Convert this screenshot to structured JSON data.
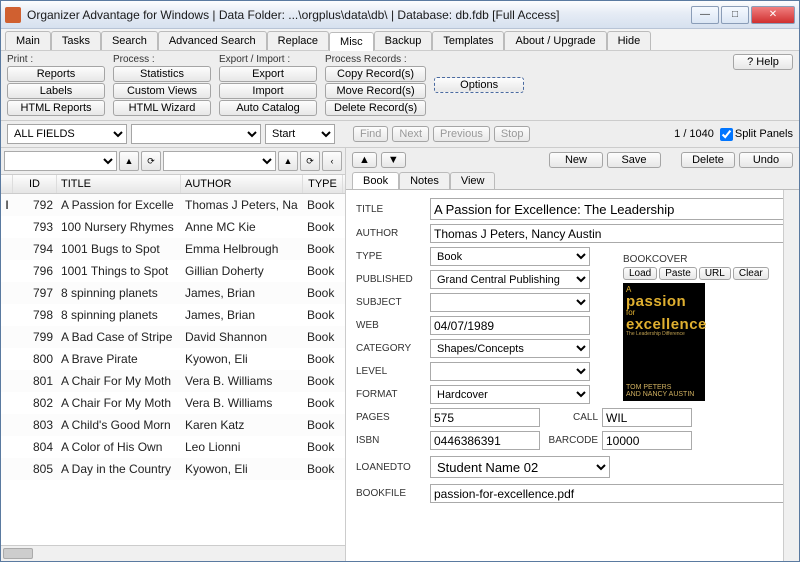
{
  "window": {
    "title": "Organizer Advantage for Windows | Data Folder: ...\\orgplus\\data\\db\\ | Database: db.fdb [Full Access]"
  },
  "menu": {
    "items": [
      "Main",
      "Tasks",
      "Search",
      "Advanced Search",
      "Replace",
      "Misc",
      "Backup",
      "Templates",
      "About / Upgrade",
      "Hide"
    ],
    "active": "Misc"
  },
  "ribbon": {
    "print": {
      "label": "Print :",
      "buttons": [
        "Reports",
        "Labels",
        "HTML Reports"
      ]
    },
    "process": {
      "label": "Process :",
      "buttons": [
        "Statistics",
        "Custom Views",
        "HTML Wizard"
      ]
    },
    "export": {
      "label": "Export / Import :",
      "buttons": [
        "Export",
        "Import",
        "Auto Catalog"
      ]
    },
    "records": {
      "label": "Process Records :",
      "buttons": [
        "Copy Record(s)",
        "Move Record(s)",
        "Delete Record(s)"
      ]
    },
    "options": "Options",
    "help": "Help"
  },
  "filter": {
    "field": "ALL FIELDS",
    "start": "Start",
    "nav": [
      "Find",
      "Next",
      "Previous",
      "Stop"
    ],
    "counter": "1 / 1040",
    "split": "Split Panels",
    "split_checked": true
  },
  "grid": {
    "headers": [
      "ID",
      "TITLE",
      "AUTHOR",
      "TYPE"
    ],
    "rows": [
      {
        "id": "792",
        "title": "A Passion for Excelle",
        "author": "Thomas J Peters, Na",
        "type": "Book",
        "sel": true
      },
      {
        "id": "793",
        "title": "100 Nursery Rhymes",
        "author": "Anne MC Kie",
        "type": "Book"
      },
      {
        "id": "794",
        "title": "1001 Bugs to Spot",
        "author": "Emma Helbrough",
        "type": "Book"
      },
      {
        "id": "796",
        "title": "1001 Things to Spot",
        "author": "Gillian Doherty",
        "type": "Book"
      },
      {
        "id": "797",
        "title": "8 spinning planets",
        "author": "James, Brian",
        "type": "Book"
      },
      {
        "id": "798",
        "title": "8 spinning planets",
        "author": "James, Brian",
        "type": "Book"
      },
      {
        "id": "799",
        "title": "A Bad Case of Stripe",
        "author": "David Shannon",
        "type": "Book"
      },
      {
        "id": "800",
        "title": "A Brave Pirate",
        "author": "Kyowon, Eli",
        "type": "Book"
      },
      {
        "id": "801",
        "title": "A Chair For My Moth",
        "author": "Vera B. Williams",
        "type": "Book"
      },
      {
        "id": "802",
        "title": "A Chair For My Moth",
        "author": "Vera B. Williams",
        "type": "Book"
      },
      {
        "id": "803",
        "title": "A Child's Good Morn",
        "author": "Karen Katz",
        "type": "Book"
      },
      {
        "id": "804",
        "title": "A Color of His Own",
        "author": "Leo Lionni",
        "type": "Book"
      },
      {
        "id": "805",
        "title": "A Day in the Country",
        "author": "Kyowon, Eli",
        "type": "Book"
      }
    ]
  },
  "actions": {
    "new": "New",
    "save": "Save",
    "delete": "Delete",
    "undo": "Undo"
  },
  "detail_tabs": [
    "Book",
    "Notes",
    "View"
  ],
  "detail": {
    "title_label": "TITLE",
    "title": "A Passion for Excellence: The Leadership",
    "author_label": "AUTHOR",
    "author": "Thomas J Peters, Nancy Austin",
    "type_label": "TYPE",
    "type": "Book",
    "published_label": "PUBLISHED",
    "published": "Grand Central Publishing",
    "subject_label": "SUBJECT",
    "subject": "",
    "web_label": "WEB",
    "web": "04/07/1989",
    "category_label": "CATEGORY",
    "category": "Shapes/Concepts",
    "level_label": "LEVEL",
    "level": "",
    "format_label": "FORMAT",
    "format": "Hardcover",
    "pages_label": "PAGES",
    "pages": "575",
    "call_label": "CALL",
    "call": "WIL",
    "isbn_label": "ISBN",
    "isbn": "0446386391",
    "barcode_label": "BARCODE",
    "barcode": "10000",
    "loaned_label": "LOANEDTO",
    "loaned": "Student Name 02",
    "bookfile_label": "BOOKFILE",
    "bookfile": "passion-for-excellence.pdf",
    "cover_label": "BOOKCOVER",
    "cover_btns": [
      "Load",
      "Paste",
      "URL",
      "Clear"
    ],
    "cover_text": {
      "a": "A",
      "p": "passion",
      "f": "for",
      "e": "excellence",
      "sub": "The Leadership Difference",
      "a1": "TOM PETERS",
      "a2": "AND NANCY AUSTIN"
    }
  }
}
